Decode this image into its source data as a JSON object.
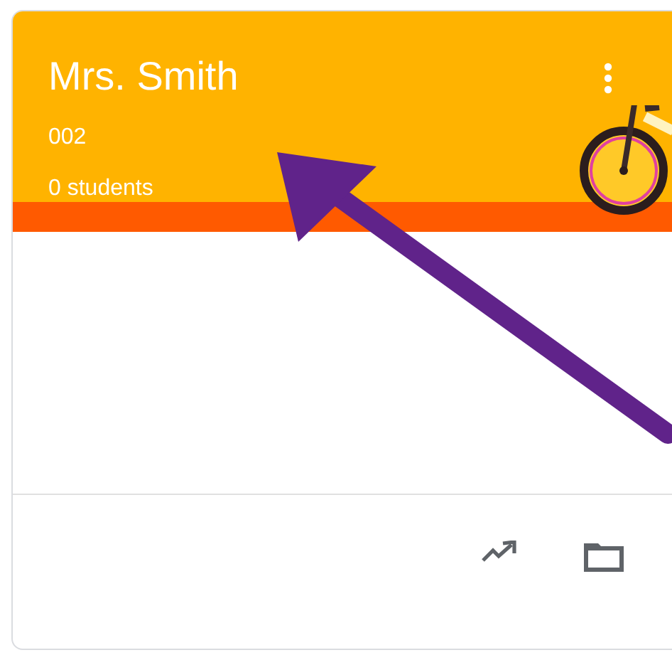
{
  "class_card": {
    "title": "Mrs. Smith",
    "section": "002",
    "students": "0 students"
  }
}
